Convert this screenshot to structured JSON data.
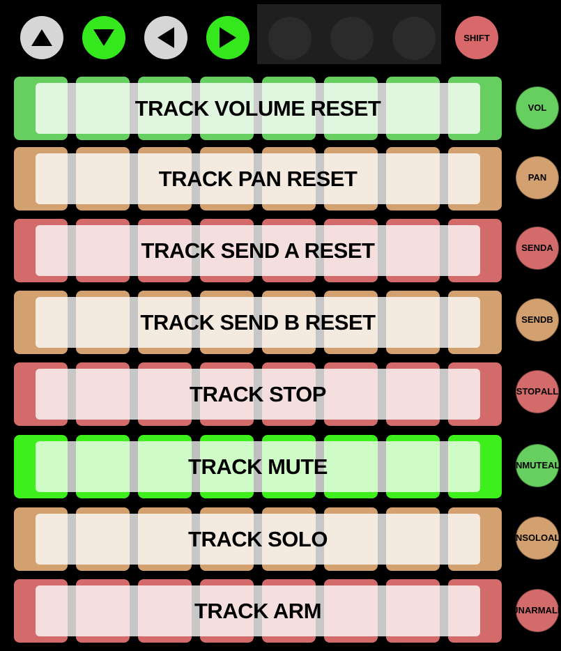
{
  "nav": {
    "up": {
      "color": "#d6d6d6"
    },
    "down": {
      "color": "#35e81e"
    },
    "left": {
      "color": "#d6d6d6"
    },
    "right": {
      "color": "#35e81e"
    }
  },
  "shift": {
    "label": "SHIFT",
    "color": "#d9686a"
  },
  "rows": [
    {
      "label": "TRACK VOLUME RESET",
      "pad_color": "#67cf5f",
      "overlay": "rgba(255,255,255,0.8)",
      "side": {
        "line1": "VOL",
        "line2": "",
        "color": "#67cf5f"
      }
    },
    {
      "label": "TRACK PAN RESET",
      "pad_color": "#d3a06f",
      "overlay": "rgba(255,255,255,0.78)",
      "side": {
        "line1": "PAN",
        "line2": "",
        "color": "#d3a06f"
      }
    },
    {
      "label": "TRACK SEND A RESET",
      "pad_color": "#d26b6a",
      "overlay": "rgba(255,255,255,0.78)",
      "side": {
        "line1": "SEND",
        "line2": "A",
        "color": "#d26b6a"
      }
    },
    {
      "label": "TRACK SEND B RESET",
      "pad_color": "#d3a06f",
      "overlay": "rgba(255,255,255,0.78)",
      "side": {
        "line1": "SEND",
        "line2": "B",
        "color": "#d3a06f"
      }
    },
    {
      "label": "TRACK STOP",
      "pad_color": "#d26b6a",
      "overlay": "rgba(255,255,255,0.78)",
      "side": {
        "line1": "STOP",
        "line2": "ALL",
        "color": "#d26b6a"
      }
    },
    {
      "label": "TRACK MUTE",
      "pad_color": "#3df01c",
      "overlay": "rgba(255,255,255,0.75)",
      "side": {
        "line1": "UNMUTE",
        "line2": "ALL",
        "color": "#67cf5f"
      }
    },
    {
      "label": "TRACK SOLO",
      "pad_color": "#d3a06f",
      "overlay": "rgba(255,255,255,0.78)",
      "side": {
        "line1": "UNSOLO",
        "line2": "ALL",
        "color": "#d3a06f"
      }
    },
    {
      "label": "TRACK ARM",
      "pad_color": "#d26b6a",
      "overlay": "rgba(255,255,255,0.78)",
      "side": {
        "line1": "UNARM",
        "line2": "ALL",
        "color": "#d26b6a"
      }
    }
  ]
}
